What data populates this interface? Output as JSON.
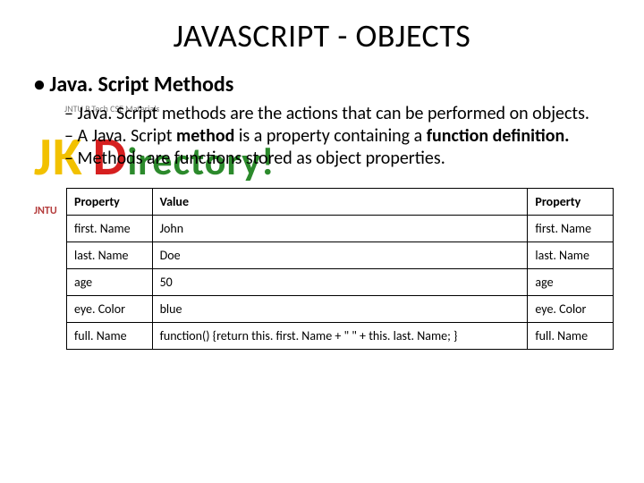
{
  "title": "JAVASCRIPT - OBJECTS",
  "section_heading": "Java. Script Methods",
  "bullets": [
    {
      "pre": "Java. Script methods are the actions that can be performed on objects.",
      "bold": "",
      "post": ""
    },
    {
      "pre": "A Java. Script ",
      "bold": "method",
      "post": " is a property containing a "
    },
    {
      "pre": "",
      "bold": "function definition.",
      "post": ""
    },
    {
      "pre": "Methods are functions stored as object properties.",
      "bold": "",
      "post": ""
    }
  ],
  "watermark": {
    "small_top": "JNTU B.Tech CSE Materials",
    "jk_j": "JK",
    "dir_d": "D",
    "dir_rest": "irectory!",
    "jntu": "JNTU"
  },
  "table": {
    "headers": [
      "Property",
      "Value",
      "Property"
    ],
    "rows": [
      [
        "first. Name",
        "John",
        "first. Name"
      ],
      [
        "last. Name",
        "Doe",
        "last. Name"
      ],
      [
        "age",
        "50",
        "age"
      ],
      [
        "eye. Color",
        "blue",
        "eye. Color"
      ],
      [
        "full. Name",
        "function() {return this. first. Name + \" \" + this. last. Name; }",
        "full. Name"
      ]
    ]
  }
}
